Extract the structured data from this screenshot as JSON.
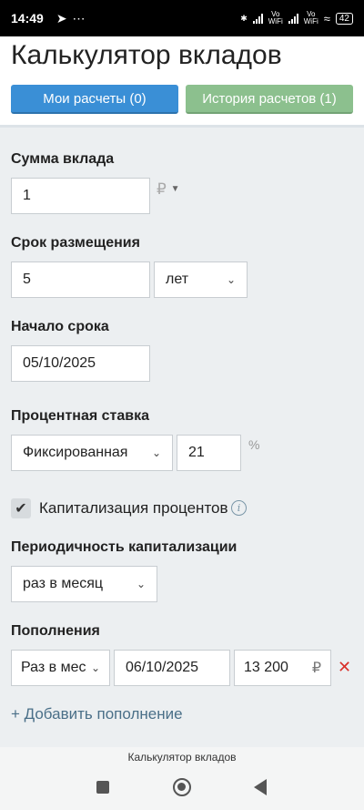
{
  "status_bar": {
    "time": "14:49",
    "vowifi": "Vo\nWiFi",
    "battery": "42"
  },
  "header": {
    "title": "Калькулятор вкладов",
    "my_calcs_button": "Мои расчеты (0)",
    "history_button": "История расчетов (1)"
  },
  "form": {
    "deposit_amount": {
      "label": "Сумма вклада",
      "value": "1",
      "currency": "₽"
    },
    "term": {
      "label": "Срок размещения",
      "value": "5",
      "unit_option": "лет"
    },
    "start_date": {
      "label": "Начало срока",
      "value": "05/10/2025"
    },
    "rate": {
      "label": "Процентная ставка",
      "type_option": "Фиксированная",
      "value": "21",
      "unit": "%"
    },
    "capitalization": {
      "label": "Капитализация процентов",
      "checked": true
    },
    "cap_period": {
      "label": "Периодичность капитализации",
      "option": "раз в месяц"
    },
    "replenishment": {
      "label": "Пополнения",
      "frequency_option": "Раз в месяц",
      "date": "06/10/2025",
      "amount": "13 200",
      "currency": "₽"
    },
    "add_replenishment": "+ Добавить пополнение"
  },
  "nav_bar": {
    "caption": "Калькулятор вкладов"
  },
  "colors": {
    "blue_button": "#3a8fd6",
    "green_button": "#8cc08e",
    "remove": "#d9302a",
    "link": "#4a6f88"
  }
}
